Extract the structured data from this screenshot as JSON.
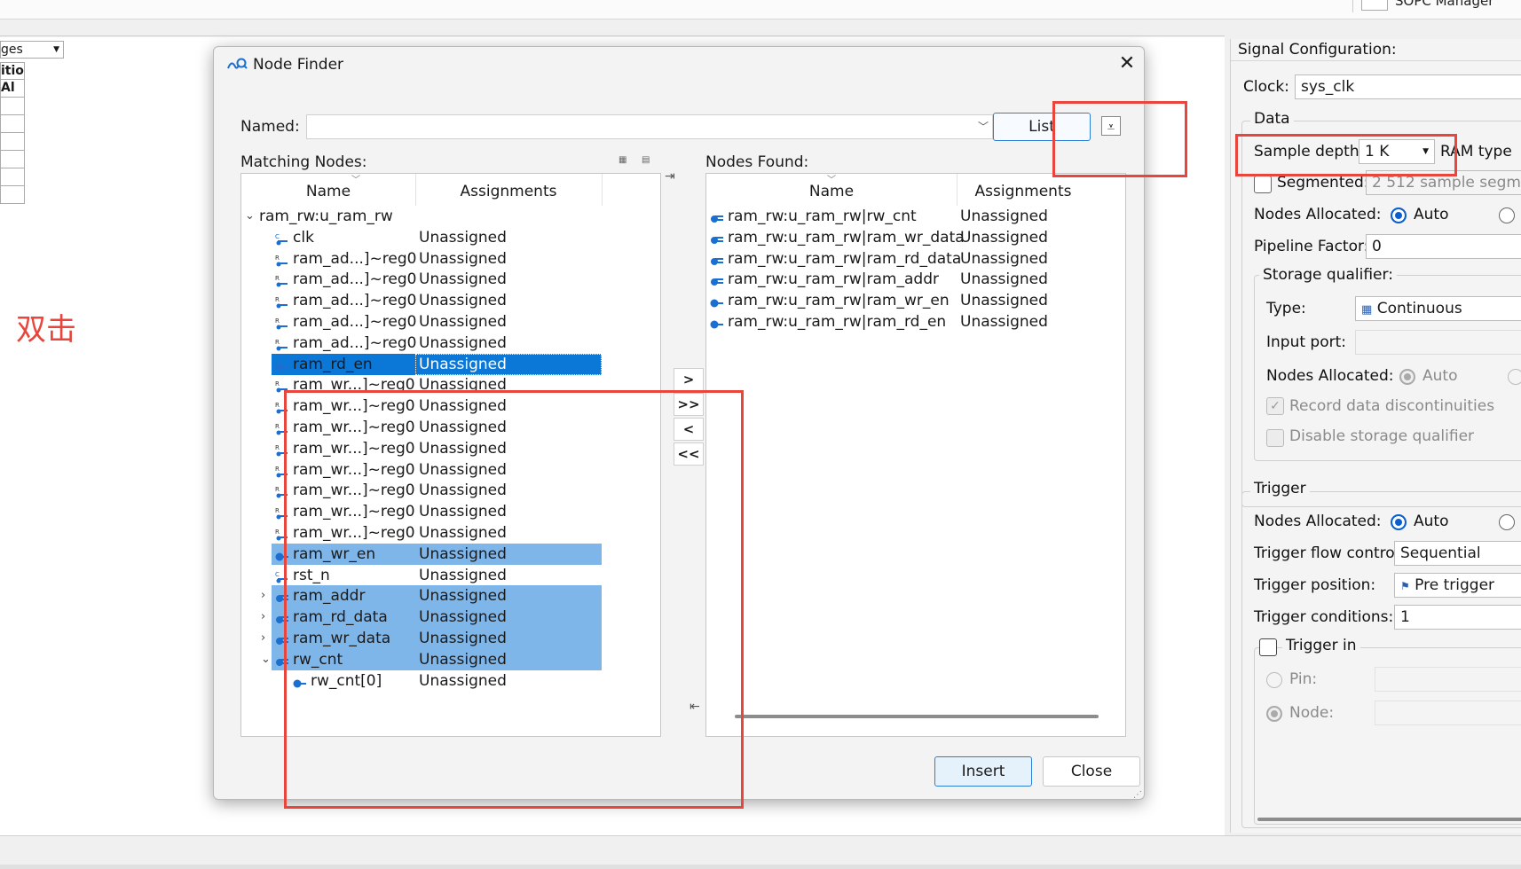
{
  "background": {
    "top_right_label": "SOPC Manager",
    "left_combo_value": "ges",
    "left_table_cells": [
      "itio",
      "Al",
      "",
      "",
      "",
      "",
      "",
      ""
    ],
    "annotation_text": "双击"
  },
  "dialog": {
    "title": "Node Finder",
    "close_glyph": "✕",
    "named_label": "Named:",
    "named_value": "",
    "list_button": "List",
    "matching_label": "Matching Nodes:",
    "found_label": "Nodes Found:",
    "insert_button": "Insert",
    "close_button": "Close",
    "matching_columns": [
      "Name",
      "Assignments"
    ],
    "found_columns": [
      "Name",
      "Assignments"
    ],
    "matching_nodes": [
      {
        "name": "ram_rw:u_ram_rw",
        "assignment": "",
        "indent": 0,
        "expander": "v",
        "icon": "none",
        "selected": "none"
      },
      {
        "name": "clk",
        "assignment": "Unassigned",
        "indent": 1,
        "expander": "",
        "icon": "clock-pin-icon",
        "selected": "none"
      },
      {
        "name": "ram_ad...]~reg0",
        "assignment": "Unassigned",
        "indent": 1,
        "expander": "",
        "icon": "register-icon",
        "selected": "none"
      },
      {
        "name": "ram_ad...]~reg0",
        "assignment": "Unassigned",
        "indent": 1,
        "expander": "",
        "icon": "register-icon",
        "selected": "none"
      },
      {
        "name": "ram_ad...]~reg0",
        "assignment": "Unassigned",
        "indent": 1,
        "expander": "",
        "icon": "register-icon",
        "selected": "none"
      },
      {
        "name": "ram_ad...]~reg0",
        "assignment": "Unassigned",
        "indent": 1,
        "expander": "",
        "icon": "register-icon",
        "selected": "none"
      },
      {
        "name": "ram_ad...]~reg0",
        "assignment": "Unassigned",
        "indent": 1,
        "expander": "",
        "icon": "register-icon",
        "selected": "none"
      },
      {
        "name": "ram_rd_en",
        "assignment": "Unassigned",
        "indent": 1,
        "expander": "",
        "icon": "combinational-icon",
        "selected": "dark"
      },
      {
        "name": "ram_wr...]~reg0",
        "assignment": "Unassigned",
        "indent": 1,
        "expander": "",
        "icon": "register-icon",
        "selected": "none"
      },
      {
        "name": "ram_wr...]~reg0",
        "assignment": "Unassigned",
        "indent": 1,
        "expander": "",
        "icon": "register-icon",
        "selected": "none"
      },
      {
        "name": "ram_wr...]~reg0",
        "assignment": "Unassigned",
        "indent": 1,
        "expander": "",
        "icon": "register-icon",
        "selected": "none"
      },
      {
        "name": "ram_wr...]~reg0",
        "assignment": "Unassigned",
        "indent": 1,
        "expander": "",
        "icon": "register-icon",
        "selected": "none"
      },
      {
        "name": "ram_wr...]~reg0",
        "assignment": "Unassigned",
        "indent": 1,
        "expander": "",
        "icon": "register-icon",
        "selected": "none"
      },
      {
        "name": "ram_wr...]~reg0",
        "assignment": "Unassigned",
        "indent": 1,
        "expander": "",
        "icon": "register-icon",
        "selected": "none"
      },
      {
        "name": "ram_wr...]~reg0",
        "assignment": "Unassigned",
        "indent": 1,
        "expander": "",
        "icon": "register-icon",
        "selected": "none"
      },
      {
        "name": "ram_wr...]~reg0",
        "assignment": "Unassigned",
        "indent": 1,
        "expander": "",
        "icon": "register-icon",
        "selected": "none"
      },
      {
        "name": "ram_wr_en",
        "assignment": "Unassigned",
        "indent": 1,
        "expander": "",
        "icon": "combinational-icon",
        "selected": "light"
      },
      {
        "name": "rst_n",
        "assignment": "Unassigned",
        "indent": 1,
        "expander": "",
        "icon": "clock-pin-icon",
        "selected": "none"
      },
      {
        "name": "ram_addr",
        "assignment": "Unassigned",
        "indent": 1,
        "expander": ">",
        "icon": "bus-icon",
        "selected": "light"
      },
      {
        "name": "ram_rd_data",
        "assignment": "Unassigned",
        "indent": 1,
        "expander": ">",
        "icon": "bus-icon",
        "selected": "light"
      },
      {
        "name": "ram_wr_data",
        "assignment": "Unassigned",
        "indent": 1,
        "expander": ">",
        "icon": "bus-icon",
        "selected": "light"
      },
      {
        "name": "rw_cnt",
        "assignment": "Unassigned",
        "indent": 1,
        "expander": "v",
        "icon": "bus-icon",
        "selected": "light"
      },
      {
        "name": "rw_cnt[0]",
        "assignment": "Unassigned",
        "indent": 2,
        "expander": "",
        "icon": "combinational-icon",
        "selected": "none"
      }
    ],
    "found_nodes": [
      {
        "name": "ram_rw:u_ram_rw|rw_cnt",
        "assignment": "Unassigned",
        "icon": "bus-icon"
      },
      {
        "name": "ram_rw:u_ram_rw|ram_wr_data",
        "assignment": "Unassigned",
        "icon": "bus-icon"
      },
      {
        "name": "ram_rw:u_ram_rw|ram_rd_data",
        "assignment": "Unassigned",
        "icon": "bus-icon"
      },
      {
        "name": "ram_rw:u_ram_rw|ram_addr",
        "assignment": "Unassigned",
        "icon": "bus-icon"
      },
      {
        "name": "ram_rw:u_ram_rw|ram_wr_en",
        "assignment": "Unassigned",
        "icon": "combinational-icon"
      },
      {
        "name": "ram_rw:u_ram_rw|ram_rd_en",
        "assignment": "Unassigned",
        "icon": "combinational-icon"
      }
    ],
    "move_buttons": [
      ">",
      ">>",
      "<",
      "<<"
    ]
  },
  "signal_config": {
    "title": "Signal Configuration:",
    "clock_label": "Clock:",
    "clock_value": "sys_clk",
    "data_group": "Data",
    "sample_depth_label": "Sample depth:",
    "sample_depth_value": "1 K",
    "ram_type_label": "RAM type",
    "segmented_label": "Segmented:",
    "segmented_value": "2  512 sample segm",
    "nodes_allocated_label": "Nodes Allocated:",
    "auto_label": "Auto",
    "pipeline_label": "Pipeline Factor:",
    "pipeline_value": "0",
    "storage_label": "Storage qualifier:",
    "type_label": "Type:",
    "type_value": "Continuous",
    "input_port_label": "Input port:",
    "sq_nodes_allocated_label": "Nodes Allocated:",
    "sq_auto_label": "Auto",
    "record_label": "Record data discontinuities",
    "disable_label": "Disable storage qualifier",
    "trigger_group": "Trigger",
    "trig_nodes_allocated_label": "Nodes Allocated:",
    "trig_auto_label": "Auto",
    "flow_label": "Trigger flow control:",
    "flow_value": "Sequential",
    "position_label": "Trigger position:",
    "position_value": "Pre trigger",
    "conditions_label": "Trigger conditions:",
    "conditions_value": "1",
    "trigger_in_label": "Trigger in",
    "pin_label": "Pin:",
    "node_label": "Node:"
  },
  "colors": {
    "selection_dark": "#0b78d7",
    "selection_light": "#7fb6ea",
    "annotation_red": "#e8453c",
    "accent_blue": "#2b7fd6"
  }
}
